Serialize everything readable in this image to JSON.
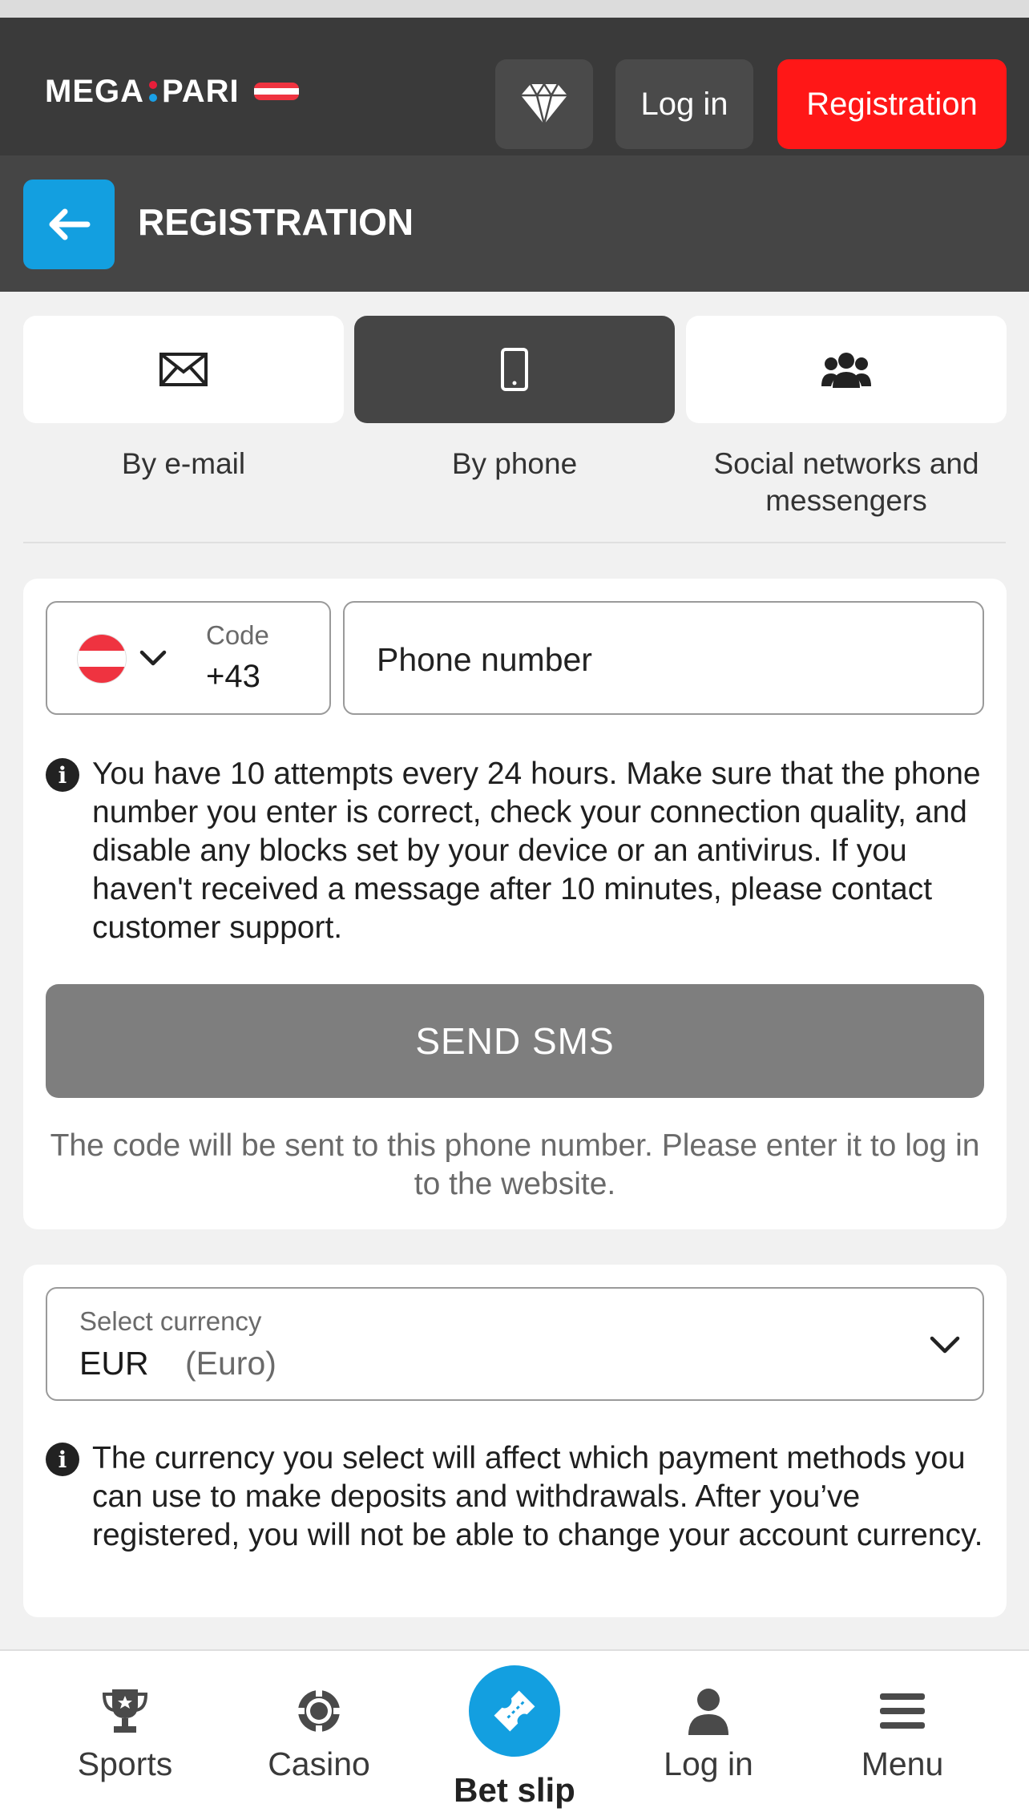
{
  "header": {
    "logo_left": "MEGA",
    "logo_right": "PARI",
    "login_label": "Log in",
    "register_label": "Registration"
  },
  "subheader": {
    "title": "REGISTRATION"
  },
  "methods": [
    {
      "label": "By e-mail",
      "icon": "envelope-icon"
    },
    {
      "label": "By phone",
      "icon": "smartphone-icon",
      "selected": true
    },
    {
      "label": "Social networks and messengers",
      "icon": "users-icon"
    }
  ],
  "phone": {
    "code_label": "Code",
    "code_value": "+43",
    "country": "Austria",
    "phone_placeholder": "Phone number",
    "info": "You have 10 attempts every 24 hours. Make sure that the phone number you enter is correct, check your connection quality, and disable any blocks set by your device or an antivirus. If you haven't received a message after 10 minutes, please contact customer support.",
    "send_label": "SEND SMS",
    "hint": "The code will be sent to this phone number. Please enter it to log in to the website."
  },
  "currency": {
    "label": "Select currency",
    "code": "EUR",
    "name": "(Euro)",
    "info": "The currency you select will affect which payment methods you can use to make deposits and withdrawals. After you’ve registered, you will not be able to change your account currency."
  },
  "bottom_nav": {
    "sports": "Sports",
    "casino": "Casino",
    "betslip": "Bet slip",
    "login": "Log in",
    "menu": "Menu"
  },
  "colors": {
    "header_bg": "#3a3a3a",
    "accent_blue": "#139fe0",
    "register_red": "#ff1717",
    "send_button_disabled": "#7e7e7e"
  }
}
